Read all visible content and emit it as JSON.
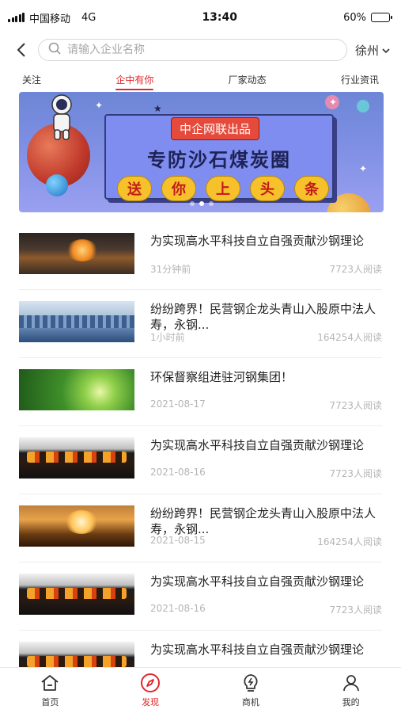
{
  "status_bar": {
    "carrier": "中国移动",
    "network": "4G",
    "time": "13:40",
    "battery": "60%",
    "battery_level": 0.6
  },
  "header": {
    "search_placeholder": "请输入企业名称",
    "city": "徐州"
  },
  "tabs": [
    {
      "label": "关注",
      "active": false
    },
    {
      "label": "企中有你",
      "active": true
    },
    {
      "label": "厂家动态",
      "active": false
    },
    {
      "label": "行业资讯",
      "active": false
    }
  ],
  "banner": {
    "tag": "中企网联出品",
    "title": "专防沙石煤炭圈",
    "pills": [
      "送",
      "你",
      "上",
      "头",
      "条"
    ],
    "slide_count": 3,
    "active_slide": 1
  },
  "news": [
    {
      "title": "为实现高水平科技自立自强贡献沙钢理论",
      "time": "31分钟前",
      "reads": "7723人阅读",
      "thumb": "steel"
    },
    {
      "title": "纷纷跨界！民营钢企龙头青山入股原中法人寿，永钢...",
      "time": "1小时前",
      "reads": "164254人阅读",
      "thumb": "factory"
    },
    {
      "title": "环保督察组进驻河钢集团！",
      "time": "2021-08-17",
      "reads": "7723人阅读",
      "thumb": "green"
    },
    {
      "title": "为实现高水平科技自立自强贡献沙钢理论",
      "time": "2021-08-16",
      "reads": "7723人阅读",
      "thumb": "grill"
    },
    {
      "title": "纷纷跨界！民营钢企龙头青山入股原中法人寿，永钢...",
      "time": "2021-08-15",
      "reads": "164254人阅读",
      "thumb": "furnace"
    },
    {
      "title": "为实现高水平科技自立自强贡献沙钢理论",
      "time": "2021-08-16",
      "reads": "7723人阅读",
      "thumb": "grill"
    },
    {
      "title": "为实现高水平科技自立自强贡献沙钢理论",
      "time": "",
      "reads": "",
      "thumb": "grill"
    }
  ],
  "bottom_nav": [
    {
      "label": "首页",
      "icon": "home-icon",
      "active": false
    },
    {
      "label": "发现",
      "icon": "compass-icon",
      "active": true
    },
    {
      "label": "商机",
      "icon": "lightbulb-icon",
      "active": false
    },
    {
      "label": "我的",
      "icon": "user-icon",
      "active": false
    }
  ],
  "colors": {
    "accent": "#e3262a",
    "banner_bg": "#7f8fe4"
  }
}
